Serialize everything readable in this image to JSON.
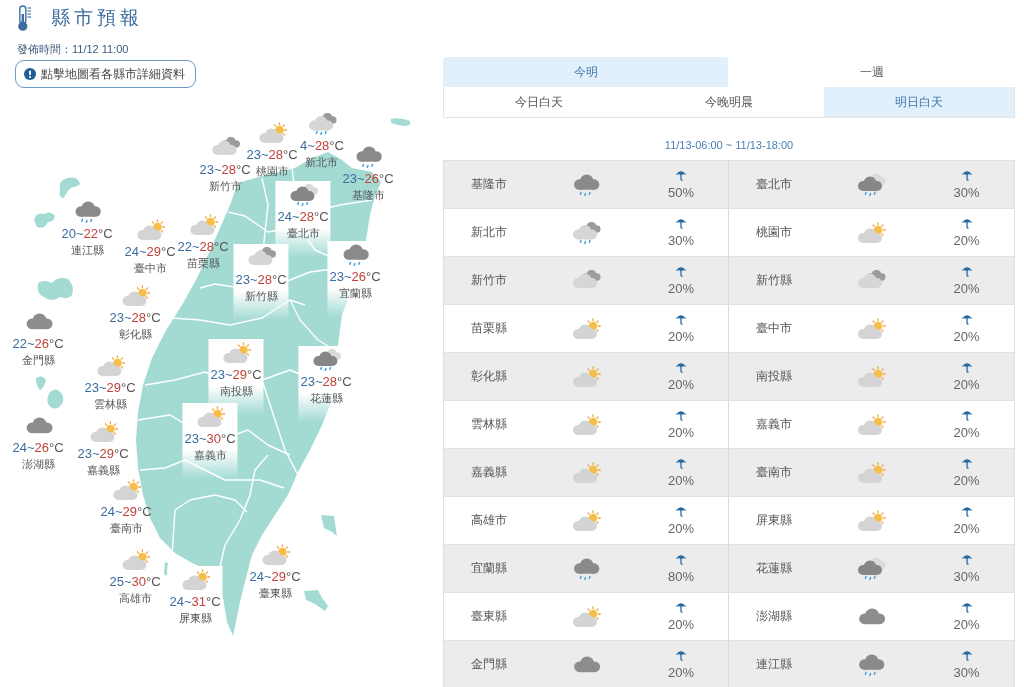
{
  "header": {
    "title": "縣市預報",
    "published": "發佈時間：11/12 11:00",
    "hint": "點擊地圖看各縣市詳細資料"
  },
  "map": {
    "markers": [
      {
        "name": "新竹市",
        "kind": "cloudy",
        "low": "23",
        "separator": "~",
        "high": "28",
        "unit": "°C"
      },
      {
        "name": "桃園市",
        "kind": "sun-cloud",
        "low": "23",
        "separator": "~",
        "high": "28",
        "unit": "°C"
      },
      {
        "name": "新北市",
        "kind": "light-rain",
        "low": "4",
        "separator": "~",
        "high": "28",
        "unit": "°C"
      },
      {
        "name": "基隆市",
        "kind": "rain",
        "low": "23",
        "separator": "~",
        "high": "26",
        "unit": "°C"
      },
      {
        "name": "臺北市",
        "kind": "cloud-rain",
        "low": "24",
        "separator": "~",
        "high": "28",
        "unit": "°C"
      },
      {
        "name": "連江縣",
        "kind": "rain",
        "low": "20",
        "separator": "~",
        "high": "22",
        "unit": "°C"
      },
      {
        "name": "臺中市",
        "kind": "sun-cloud",
        "low": "24",
        "separator": "~",
        "high": "29",
        "unit": "°C"
      },
      {
        "name": "苗栗縣",
        "kind": "sun-cloud",
        "low": "22",
        "separator": "~",
        "high": "28",
        "unit": "°C"
      },
      {
        "name": "新竹縣",
        "kind": "cloudy",
        "low": "23",
        "separator": "~",
        "high": "28",
        "unit": "°C"
      },
      {
        "name": "宜蘭縣",
        "kind": "rain",
        "low": "23",
        "separator": "~",
        "high": "26",
        "unit": "°C"
      },
      {
        "name": "彰化縣",
        "kind": "sun-cloud",
        "low": "23",
        "separator": "~",
        "high": "28",
        "unit": "°C"
      },
      {
        "name": "金門縣",
        "kind": "overcast",
        "low": "22",
        "separator": "~",
        "high": "26",
        "unit": "°C"
      },
      {
        "name": "南投縣",
        "kind": "sun-cloud",
        "low": "23",
        "separator": "~",
        "high": "29",
        "unit": "°C"
      },
      {
        "name": "花蓮縣",
        "kind": "cloud-rain",
        "low": "23",
        "separator": "~",
        "high": "28",
        "unit": "°C"
      },
      {
        "name": "雲林縣",
        "kind": "sun-cloud",
        "low": "23",
        "separator": "~",
        "high": "29",
        "unit": "°C"
      },
      {
        "name": "嘉義市",
        "kind": "sun-cloud",
        "low": "23",
        "separator": "~",
        "high": "30",
        "unit": "°C"
      },
      {
        "name": "澎湖縣",
        "kind": "overcast",
        "low": "24",
        "separator": "~",
        "high": "26",
        "unit": "°C"
      },
      {
        "name": "嘉義縣",
        "kind": "sun-cloud",
        "low": "23",
        "separator": "~",
        "high": "29",
        "unit": "°C"
      },
      {
        "name": "臺南市",
        "kind": "sun-cloud",
        "low": "24",
        "separator": "~",
        "high": "29",
        "unit": "°C"
      },
      {
        "name": "高雄市",
        "kind": "sun-cloud",
        "low": "25",
        "separator": "~",
        "high": "30",
        "unit": "°C"
      },
      {
        "name": "屏東縣",
        "kind": "sun-cloud",
        "low": "24",
        "separator": "~",
        "high": "31",
        "unit": "°C"
      },
      {
        "name": "臺東縣",
        "kind": "sun-cloud",
        "low": "24",
        "separator": "~",
        "high": "29",
        "unit": "°C"
      }
    ]
  },
  "period_tabs": [
    {
      "label": "今明",
      "selected": true
    },
    {
      "label": "一週",
      "selected": false
    }
  ],
  "time_tabs": [
    {
      "label": "今日白天",
      "selected": false
    },
    {
      "label": "今晚明晨",
      "selected": false
    },
    {
      "label": "明日白天",
      "selected": true
    }
  ],
  "time_range": "11/13-06:00 ~ 11/13-18:00",
  "forecast_table": {
    "cells": [
      {
        "name": "基隆市",
        "kind": "rain",
        "rain_chance": "50%"
      },
      {
        "name": "臺北市",
        "kind": "cloud-rain",
        "rain_chance": "30%"
      },
      {
        "name": "新北市",
        "kind": "light-rain",
        "rain_chance": "30%"
      },
      {
        "name": "桃園市",
        "kind": "sun-cloud",
        "rain_chance": "20%"
      },
      {
        "name": "新竹市",
        "kind": "cloudy",
        "rain_chance": "20%"
      },
      {
        "name": "新竹縣",
        "kind": "cloudy",
        "rain_chance": "20%"
      },
      {
        "name": "苗栗縣",
        "kind": "sun-cloud",
        "rain_chance": "20%"
      },
      {
        "name": "臺中市",
        "kind": "sun-cloud",
        "rain_chance": "20%"
      },
      {
        "name": "彰化縣",
        "kind": "sun-cloud",
        "rain_chance": "20%"
      },
      {
        "name": "南投縣",
        "kind": "sun-cloud",
        "rain_chance": "20%"
      },
      {
        "name": "雲林縣",
        "kind": "sun-cloud",
        "rain_chance": "20%"
      },
      {
        "name": "嘉義市",
        "kind": "sun-cloud",
        "rain_chance": "20%"
      },
      {
        "name": "嘉義縣",
        "kind": "sun-cloud",
        "rain_chance": "20%"
      },
      {
        "name": "臺南市",
        "kind": "sun-cloud",
        "rain_chance": "20%"
      },
      {
        "name": "高雄市",
        "kind": "sun-cloud",
        "rain_chance": "20%"
      },
      {
        "name": "屏東縣",
        "kind": "sun-cloud",
        "rain_chance": "20%"
      },
      {
        "name": "宜蘭縣",
        "kind": "rain",
        "rain_chance": "80%"
      },
      {
        "name": "花蓮縣",
        "kind": "cloud-rain",
        "rain_chance": "30%"
      },
      {
        "name": "臺東縣",
        "kind": "sun-cloud",
        "rain_chance": "20%"
      },
      {
        "name": "澎湖縣",
        "kind": "overcast",
        "rain_chance": "20%"
      },
      {
        "name": "金門縣",
        "kind": "overcast",
        "rain_chance": "20%"
      },
      {
        "name": "連江縣",
        "kind": "rain",
        "rain_chance": "30%"
      }
    ]
  }
}
